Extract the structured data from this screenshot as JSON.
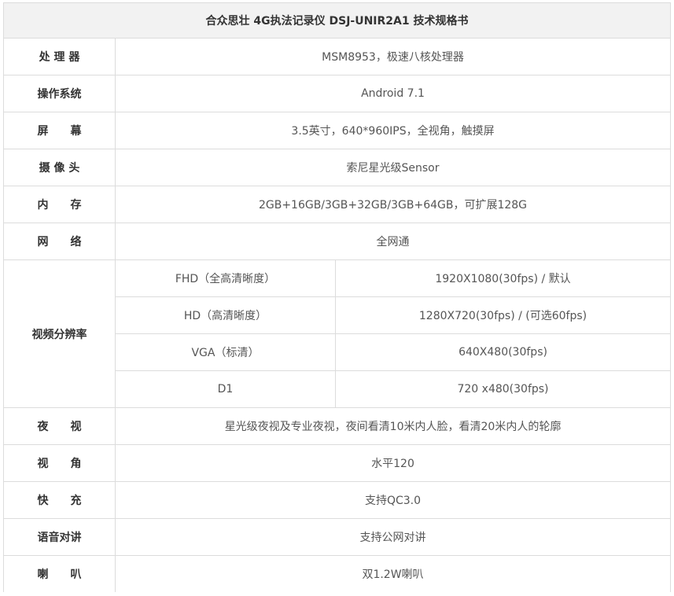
{
  "title": "合众思壮 4G执法记录仪 DSJ-UNIR2A1 技术规格书",
  "rows": [
    {
      "label": "处 理 器",
      "value": "MSM8953，极速八核处理器"
    },
    {
      "label": "操作系统",
      "value": "Android 7.1"
    },
    {
      "label": "屏　　幕",
      "value": "3.5英寸，640*960IPS，全视角，触摸屏"
    },
    {
      "label": "摄 像 头",
      "value": "索尼星光级Sensor"
    },
    {
      "label": "内　　存",
      "value": "2GB+16GB/3GB+32GB/3GB+64GB，可扩展128G"
    },
    {
      "label": "网　　络",
      "value": "全网通"
    }
  ],
  "video": {
    "label": "视频分辨率",
    "modes": [
      {
        "name": "FHD（全高清晰度）",
        "value": "1920X1080(30fps) / 默认"
      },
      {
        "name": "HD（高清晰度）",
        "value": "1280X720(30fps) / (可选60fps)"
      },
      {
        "name": "VGA（标清）",
        "value": "640X480(30fps)"
      },
      {
        "name": "D1",
        "value": "720 x480(30fps)"
      }
    ]
  },
  "rows2": [
    {
      "label": "夜　　视",
      "value": "星光级夜视及专业夜视，夜间看清10米内人脸，看清20米内人的轮廓"
    },
    {
      "label": "视　　角",
      "value": "水平120"
    },
    {
      "label": "快　　充",
      "value": "支持QC3.0"
    },
    {
      "label": "语音对讲",
      "value": "支持公网对讲"
    },
    {
      "label": "喇　　叭",
      "value": "双1.2W喇叭"
    }
  ]
}
